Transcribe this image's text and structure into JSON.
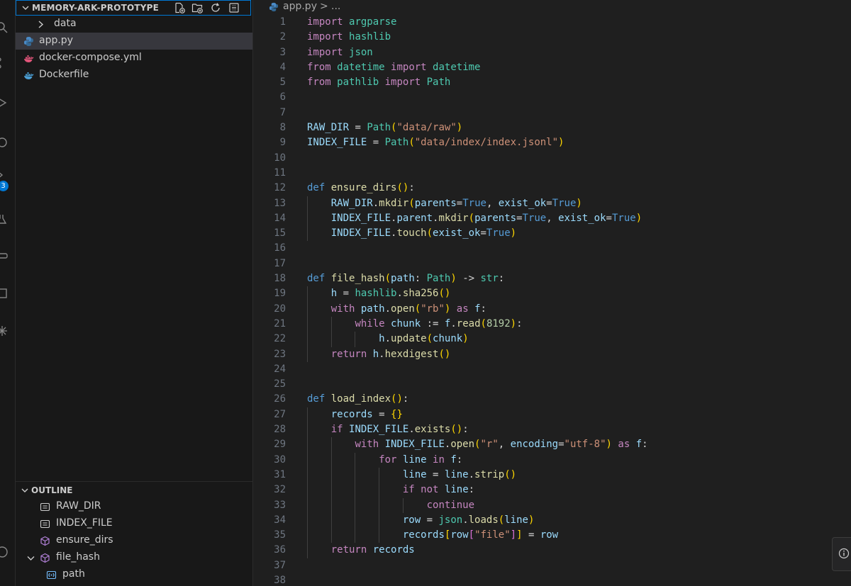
{
  "explorer": {
    "title": "MEMORY-ARK-PROTOTYPE",
    "items": [
      {
        "label": "data",
        "type": "folder"
      },
      {
        "label": "app.py",
        "type": "python",
        "selected": true
      },
      {
        "label": "docker-compose.yml",
        "type": "docker-compose"
      },
      {
        "label": "Dockerfile",
        "type": "docker"
      }
    ]
  },
  "activity_bar": {
    "badge": "3"
  },
  "outline": {
    "title": "OUTLINE",
    "items": [
      {
        "label": "RAW_DIR",
        "kind": "variable"
      },
      {
        "label": "INDEX_FILE",
        "kind": "variable"
      },
      {
        "label": "ensure_dirs",
        "kind": "function"
      },
      {
        "label": "file_hash",
        "kind": "function"
      },
      {
        "label": "path",
        "kind": "parameter"
      }
    ]
  },
  "editor": {
    "breadcrumb": {
      "file": "app.py",
      "separator": ">",
      "more": "..."
    },
    "lines": [
      {
        "n": "1",
        "indent": 0,
        "tokens": [
          [
            "kw",
            "import"
          ],
          [
            "pl",
            " "
          ],
          [
            "cls",
            "argparse"
          ]
        ]
      },
      {
        "n": "2",
        "indent": 0,
        "tokens": [
          [
            "kw",
            "import"
          ],
          [
            "pl",
            " "
          ],
          [
            "cls",
            "hashlib"
          ]
        ]
      },
      {
        "n": "3",
        "indent": 0,
        "tokens": [
          [
            "kw",
            "import"
          ],
          [
            "pl",
            " "
          ],
          [
            "cls",
            "json"
          ]
        ]
      },
      {
        "n": "4",
        "indent": 0,
        "tokens": [
          [
            "kw",
            "from"
          ],
          [
            "pl",
            " "
          ],
          [
            "cls",
            "datetime"
          ],
          [
            "pl",
            " "
          ],
          [
            "kw",
            "import"
          ],
          [
            "pl",
            " "
          ],
          [
            "cls",
            "datetime"
          ]
        ]
      },
      {
        "n": "5",
        "indent": 0,
        "tokens": [
          [
            "kw",
            "from"
          ],
          [
            "pl",
            " "
          ],
          [
            "cls",
            "pathlib"
          ],
          [
            "pl",
            " "
          ],
          [
            "kw",
            "import"
          ],
          [
            "pl",
            " "
          ],
          [
            "cls",
            "Path"
          ]
        ]
      },
      {
        "n": "6",
        "indent": 0,
        "tokens": []
      },
      {
        "n": "7",
        "indent": 0,
        "tokens": []
      },
      {
        "n": "8",
        "indent": 0,
        "tokens": [
          [
            "var",
            "RAW_DIR"
          ],
          [
            "op",
            " = "
          ],
          [
            "cls",
            "Path"
          ],
          [
            "br1",
            "("
          ],
          [
            "str",
            "\"data/raw\""
          ],
          [
            "br1",
            ")"
          ]
        ]
      },
      {
        "n": "9",
        "indent": 0,
        "tokens": [
          [
            "var",
            "INDEX_FILE"
          ],
          [
            "op",
            " = "
          ],
          [
            "cls",
            "Path"
          ],
          [
            "br1",
            "("
          ],
          [
            "str",
            "\"data/index/index.jsonl\""
          ],
          [
            "br1",
            ")"
          ]
        ]
      },
      {
        "n": "10",
        "indent": 0,
        "tokens": []
      },
      {
        "n": "11",
        "indent": 0,
        "tokens": []
      },
      {
        "n": "12",
        "indent": 0,
        "tokens": [
          [
            "def",
            "def"
          ],
          [
            "pl",
            " "
          ],
          [
            "fn",
            "ensure_dirs"
          ],
          [
            "br1",
            "()"
          ],
          [
            "pl",
            ":"
          ]
        ]
      },
      {
        "n": "13",
        "indent": 1,
        "tokens": [
          [
            "var",
            "RAW_DIR"
          ],
          [
            "pl",
            "."
          ],
          [
            "fn",
            "mkdir"
          ],
          [
            "br1",
            "("
          ],
          [
            "var",
            "parents"
          ],
          [
            "op",
            "="
          ],
          [
            "cst",
            "True"
          ],
          [
            "pl",
            ", "
          ],
          [
            "var",
            "exist_ok"
          ],
          [
            "op",
            "="
          ],
          [
            "cst",
            "True"
          ],
          [
            "br1",
            ")"
          ]
        ]
      },
      {
        "n": "14",
        "indent": 1,
        "tokens": [
          [
            "var",
            "INDEX_FILE"
          ],
          [
            "pl",
            "."
          ],
          [
            "var",
            "parent"
          ],
          [
            "pl",
            "."
          ],
          [
            "fn",
            "mkdir"
          ],
          [
            "br1",
            "("
          ],
          [
            "var",
            "parents"
          ],
          [
            "op",
            "="
          ],
          [
            "cst",
            "True"
          ],
          [
            "pl",
            ", "
          ],
          [
            "var",
            "exist_ok"
          ],
          [
            "op",
            "="
          ],
          [
            "cst",
            "True"
          ],
          [
            "br1",
            ")"
          ]
        ]
      },
      {
        "n": "15",
        "indent": 1,
        "tokens": [
          [
            "var",
            "INDEX_FILE"
          ],
          [
            "pl",
            "."
          ],
          [
            "fn",
            "touch"
          ],
          [
            "br1",
            "("
          ],
          [
            "var",
            "exist_ok"
          ],
          [
            "op",
            "="
          ],
          [
            "cst",
            "True"
          ],
          [
            "br1",
            ")"
          ]
        ]
      },
      {
        "n": "16",
        "indent": 0,
        "tokens": []
      },
      {
        "n": "17",
        "indent": 0,
        "tokens": []
      },
      {
        "n": "18",
        "indent": 0,
        "tokens": [
          [
            "def",
            "def"
          ],
          [
            "pl",
            " "
          ],
          [
            "fn",
            "file_hash"
          ],
          [
            "br1",
            "("
          ],
          [
            "var",
            "path"
          ],
          [
            "pl",
            ": "
          ],
          [
            "cls",
            "Path"
          ],
          [
            "br1",
            ")"
          ],
          [
            "pl",
            " -> "
          ],
          [
            "cls",
            "str"
          ],
          [
            "pl",
            ":"
          ]
        ]
      },
      {
        "n": "19",
        "indent": 1,
        "tokens": [
          [
            "var",
            "h"
          ],
          [
            "op",
            " = "
          ],
          [
            "cls",
            "hashlib"
          ],
          [
            "pl",
            "."
          ],
          [
            "fn",
            "sha256"
          ],
          [
            "br1",
            "()"
          ]
        ]
      },
      {
        "n": "20",
        "indent": 1,
        "tokens": [
          [
            "kw",
            "with"
          ],
          [
            "pl",
            " "
          ],
          [
            "var",
            "path"
          ],
          [
            "pl",
            "."
          ],
          [
            "fn",
            "open"
          ],
          [
            "br1",
            "("
          ],
          [
            "str",
            "\"rb\""
          ],
          [
            "br1",
            ")"
          ],
          [
            "pl",
            " "
          ],
          [
            "kw",
            "as"
          ],
          [
            "pl",
            " "
          ],
          [
            "var",
            "f"
          ],
          [
            "pl",
            ":"
          ]
        ]
      },
      {
        "n": "21",
        "indent": 2,
        "tokens": [
          [
            "kw",
            "while"
          ],
          [
            "pl",
            " "
          ],
          [
            "var",
            "chunk"
          ],
          [
            "op",
            " := "
          ],
          [
            "var",
            "f"
          ],
          [
            "pl",
            "."
          ],
          [
            "fn",
            "read"
          ],
          [
            "br1",
            "("
          ],
          [
            "num",
            "8192"
          ],
          [
            "br1",
            ")"
          ],
          [
            "pl",
            ":"
          ]
        ]
      },
      {
        "n": "22",
        "indent": 3,
        "tokens": [
          [
            "var",
            "h"
          ],
          [
            "pl",
            "."
          ],
          [
            "fn",
            "update"
          ],
          [
            "br1",
            "("
          ],
          [
            "var",
            "chunk"
          ],
          [
            "br1",
            ")"
          ]
        ]
      },
      {
        "n": "23",
        "indent": 1,
        "tokens": [
          [
            "kw",
            "return"
          ],
          [
            "pl",
            " "
          ],
          [
            "var",
            "h"
          ],
          [
            "pl",
            "."
          ],
          [
            "fn",
            "hexdigest"
          ],
          [
            "br1",
            "()"
          ]
        ]
      },
      {
        "n": "24",
        "indent": 0,
        "tokens": []
      },
      {
        "n": "25",
        "indent": 0,
        "tokens": []
      },
      {
        "n": "26",
        "indent": 0,
        "tokens": [
          [
            "def",
            "def"
          ],
          [
            "pl",
            " "
          ],
          [
            "fn",
            "load_index"
          ],
          [
            "br1",
            "()"
          ],
          [
            "pl",
            ":"
          ]
        ]
      },
      {
        "n": "27",
        "indent": 1,
        "tokens": [
          [
            "var",
            "records"
          ],
          [
            "op",
            " = "
          ],
          [
            "br1",
            "{}"
          ]
        ]
      },
      {
        "n": "28",
        "indent": 1,
        "tokens": [
          [
            "kw",
            "if"
          ],
          [
            "pl",
            " "
          ],
          [
            "var",
            "INDEX_FILE"
          ],
          [
            "pl",
            "."
          ],
          [
            "fn",
            "exists"
          ],
          [
            "br1",
            "()"
          ],
          [
            "pl",
            ":"
          ]
        ]
      },
      {
        "n": "29",
        "indent": 2,
        "tokens": [
          [
            "kw",
            "with"
          ],
          [
            "pl",
            " "
          ],
          [
            "var",
            "INDEX_FILE"
          ],
          [
            "pl",
            "."
          ],
          [
            "fn",
            "open"
          ],
          [
            "br1",
            "("
          ],
          [
            "str",
            "\"r\""
          ],
          [
            "pl",
            ", "
          ],
          [
            "var",
            "encoding"
          ],
          [
            "op",
            "="
          ],
          [
            "str",
            "\"utf-8\""
          ],
          [
            "br1",
            ")"
          ],
          [
            "pl",
            " "
          ],
          [
            "kw",
            "as"
          ],
          [
            "pl",
            " "
          ],
          [
            "var",
            "f"
          ],
          [
            "pl",
            ":"
          ]
        ]
      },
      {
        "n": "30",
        "indent": 3,
        "tokens": [
          [
            "kw",
            "for"
          ],
          [
            "pl",
            " "
          ],
          [
            "var",
            "line"
          ],
          [
            "pl",
            " "
          ],
          [
            "kw",
            "in"
          ],
          [
            "pl",
            " "
          ],
          [
            "var",
            "f"
          ],
          [
            "pl",
            ":"
          ]
        ]
      },
      {
        "n": "31",
        "indent": 4,
        "tokens": [
          [
            "var",
            "line"
          ],
          [
            "op",
            " = "
          ],
          [
            "var",
            "line"
          ],
          [
            "pl",
            "."
          ],
          [
            "fn",
            "strip"
          ],
          [
            "br1",
            "()"
          ]
        ]
      },
      {
        "n": "32",
        "indent": 4,
        "tokens": [
          [
            "kw",
            "if"
          ],
          [
            "pl",
            " "
          ],
          [
            "kw",
            "not"
          ],
          [
            "pl",
            " "
          ],
          [
            "var",
            "line"
          ],
          [
            "pl",
            ":"
          ]
        ]
      },
      {
        "n": "33",
        "indent": 5,
        "tokens": [
          [
            "kw",
            "continue"
          ]
        ]
      },
      {
        "n": "34",
        "indent": 4,
        "tokens": [
          [
            "var",
            "row"
          ],
          [
            "op",
            " = "
          ],
          [
            "cls",
            "json"
          ],
          [
            "pl",
            "."
          ],
          [
            "fn",
            "loads"
          ],
          [
            "br1",
            "("
          ],
          [
            "var",
            "line"
          ],
          [
            "br1",
            ")"
          ]
        ]
      },
      {
        "n": "35",
        "indent": 4,
        "tokens": [
          [
            "var",
            "records"
          ],
          [
            "br1",
            "["
          ],
          [
            "var",
            "row"
          ],
          [
            "br2",
            "["
          ],
          [
            "str",
            "\"file\""
          ],
          [
            "br2",
            "]"
          ],
          [
            "br1",
            "]"
          ],
          [
            "op",
            " = "
          ],
          [
            "var",
            "row"
          ]
        ]
      },
      {
        "n": "36",
        "indent": 1,
        "tokens": [
          [
            "kw",
            "return"
          ],
          [
            "pl",
            " "
          ],
          [
            "var",
            "records"
          ]
        ]
      },
      {
        "n": "37",
        "indent": 0,
        "tokens": []
      },
      {
        "n": "38",
        "indent": 0,
        "tokens": []
      }
    ]
  }
}
